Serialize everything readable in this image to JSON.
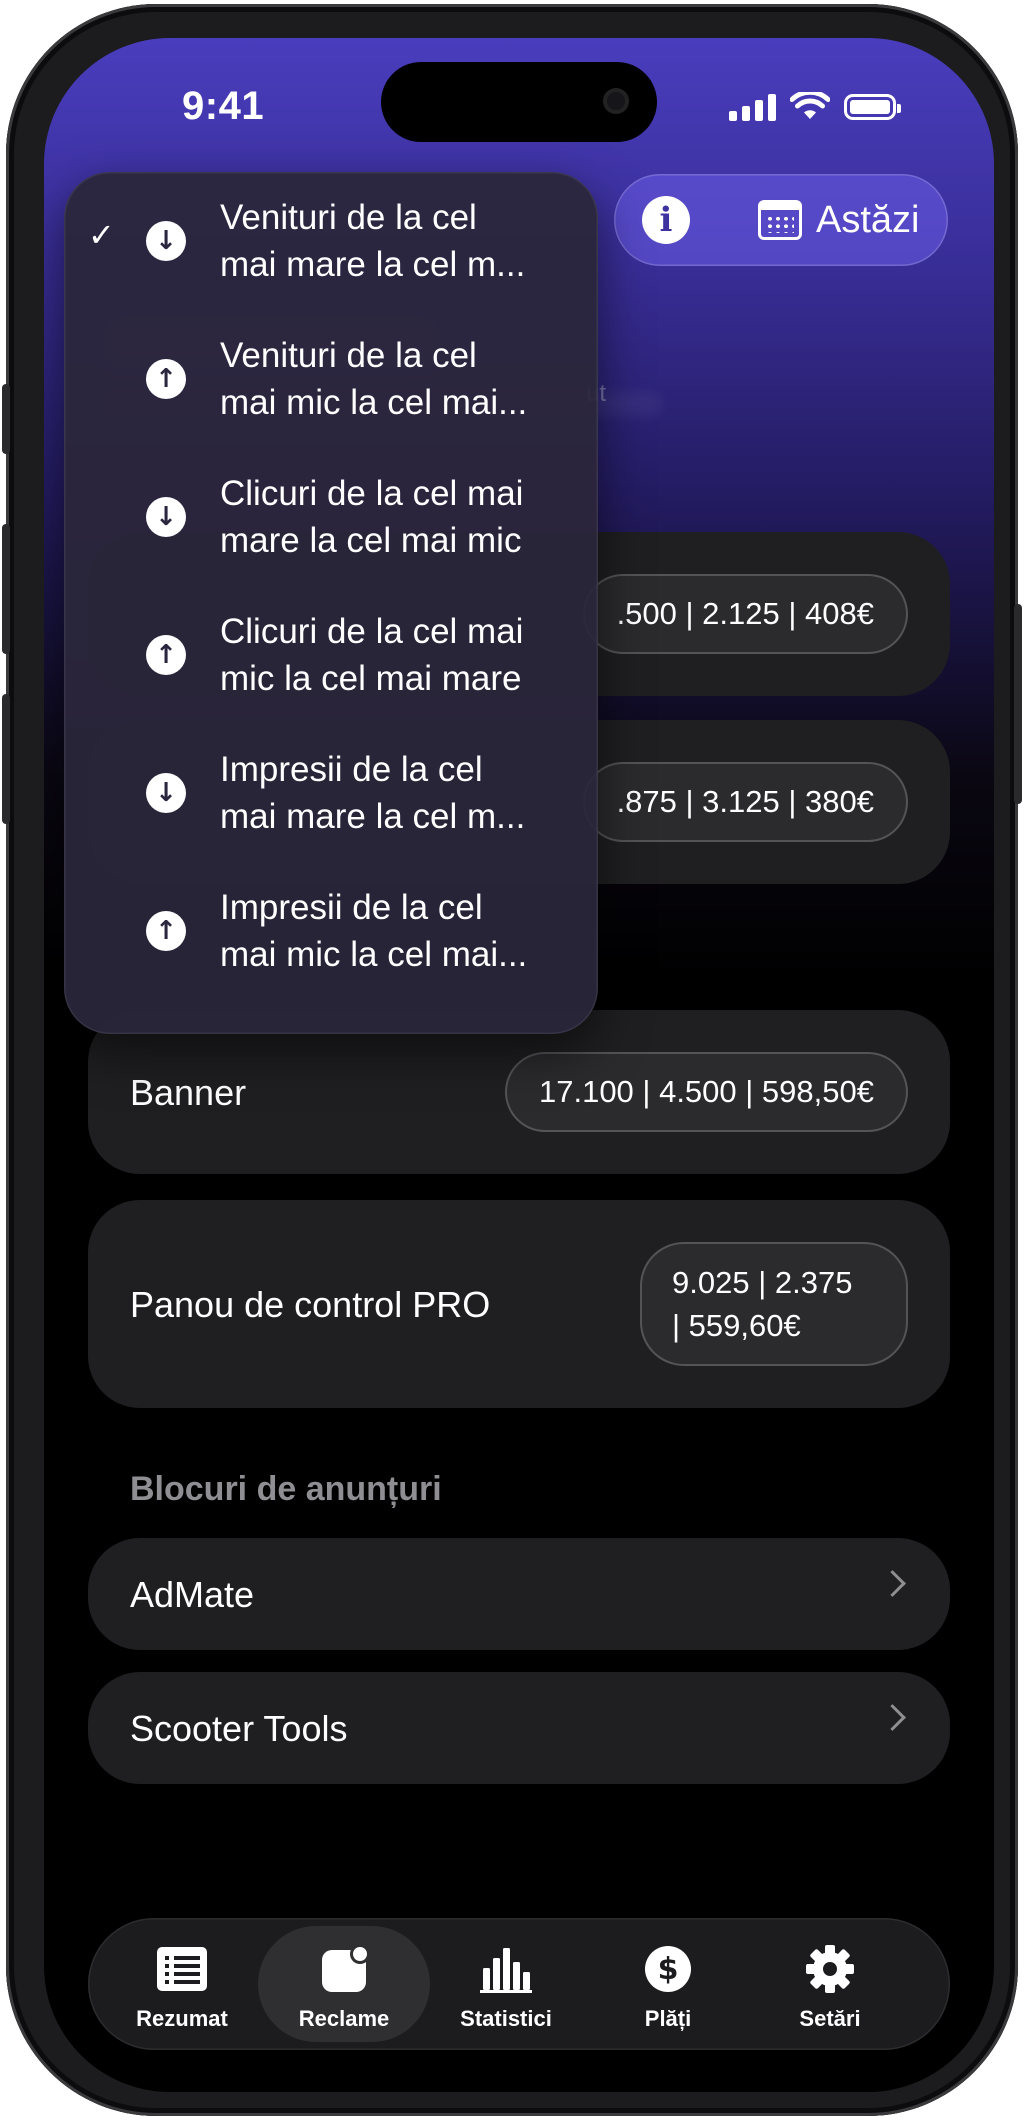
{
  "status_bar": {
    "time": "9:41"
  },
  "toolbar": {
    "info_icon": "info-icon",
    "date_label": "Astăzi",
    "date_icon": "calendar-icon"
  },
  "background_fragment": "ut",
  "sort_menu": {
    "items": [
      {
        "label": "Venituri de la cel\nmai mare la cel m...",
        "direction": "down",
        "selected": true
      },
      {
        "label": "Venituri de la cel\nmai mic la cel mai...",
        "direction": "up",
        "selected": false
      },
      {
        "label": "Clicuri de la cel mai\nmare la cel mai mic",
        "direction": "down",
        "selected": false
      },
      {
        "label": "Clicuri de la cel mai\nmic la cel mai mare",
        "direction": "up",
        "selected": false
      },
      {
        "label": "Impresii de la cel\nmai mare la cel m...",
        "direction": "down",
        "selected": false
      },
      {
        "label": "Impresii de la cel\nmai mic la cel mai...",
        "direction": "up",
        "selected": false
      }
    ],
    "check_glyph": "✓"
  },
  "placements": [
    {
      "label": "",
      "stats": ".500 | 2.125 | 408€"
    },
    {
      "label": "",
      "stats": ".875 | 3.125 | 380€"
    },
    {
      "label": "Banner",
      "stats": "17.100 | 4.500 | 598,50€"
    },
    {
      "label": "Panou de control PRO",
      "stats": "9.025 | 2.375\n| 559,60€"
    }
  ],
  "ad_blocks": {
    "title": "Blocuri de anunțuri",
    "items": [
      {
        "label": "AdMate"
      },
      {
        "label": "Scooter Tools"
      }
    ]
  },
  "tab_bar": {
    "tabs": [
      {
        "label": "Rezumat",
        "icon": "list-icon",
        "active": false
      },
      {
        "label": "Reclame",
        "icon": "ad-badge-icon",
        "active": true
      },
      {
        "label": "Statistici",
        "icon": "bar-chart-icon",
        "active": false
      },
      {
        "label": "Plăți",
        "icon": "dollar-icon",
        "active": false
      },
      {
        "label": "Setări",
        "icon": "gear-icon",
        "active": false
      }
    ]
  }
}
